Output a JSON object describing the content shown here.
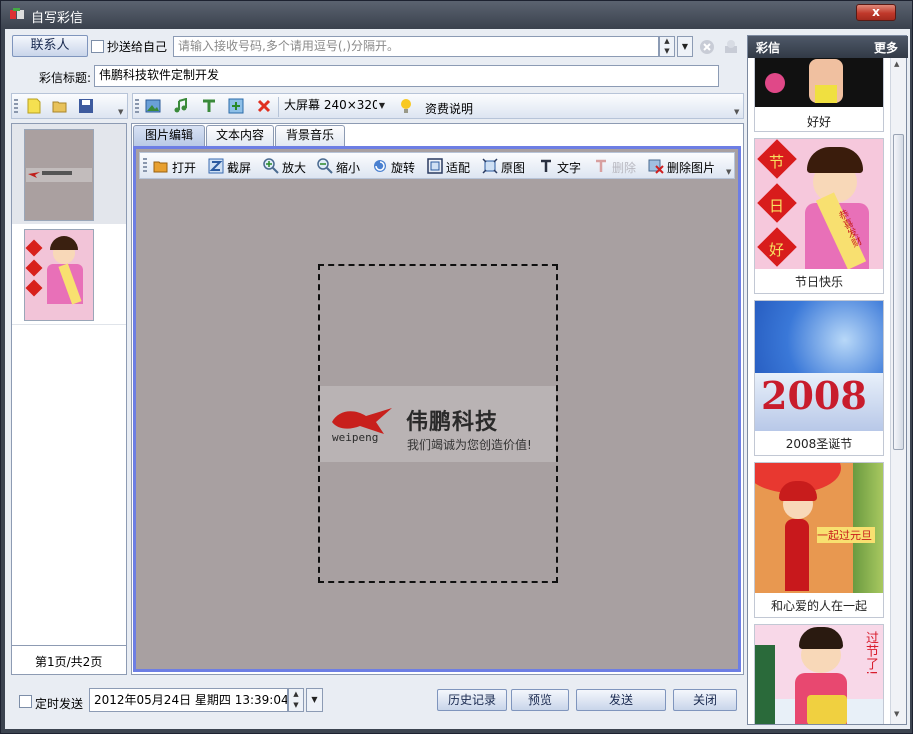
{
  "window": {
    "title": "自写彩信",
    "close_label": "x"
  },
  "header": {
    "contacts_button": "联系人",
    "cc_self_label": "抄送给自己",
    "recipient_placeholder": "请输入接收号码,多个请用逗号(,)分隔开。",
    "subject_label": "彩信标题:",
    "subject_value": "伟鹏科技软件定制开发"
  },
  "toolbar": {
    "screen_size_value": "大屏幕 240×320",
    "fee_label": "资费说明"
  },
  "slides": {
    "page_indicator": "第1页/共2页"
  },
  "tabs": [
    {
      "label": "图片编辑"
    },
    {
      "label": "文本内容"
    },
    {
      "label": "背景音乐"
    }
  ],
  "image_toolbar": {
    "open": "打开",
    "crop": "截屏",
    "zoom_in": "放大",
    "zoom_out": "缩小",
    "rotate": "旋转",
    "fit": "适配",
    "original": "原图",
    "text": "文字",
    "delete": "删除",
    "delete_image": "删除图片"
  },
  "canvas": {
    "brand_name": "伟鹏科技",
    "brand_latin": "weipeng",
    "slogan": "我们竭诚为您创造价值!"
  },
  "footer": {
    "schedule_label": "定时发送",
    "datetime_value": "2012年05月24日 星期四 13:39:04",
    "history_button": "历史记录",
    "preview_button": "预览",
    "send_button": "发送",
    "close_button": "关闭"
  },
  "gallery": {
    "title": "彩信",
    "more": "更多",
    "items": [
      {
        "caption": "好好"
      },
      {
        "caption": "节日快乐",
        "art_text": [
          "节",
          "日",
          "好"
        ],
        "scroll_text": "恭喜发财"
      },
      {
        "caption": "2008圣诞节",
        "art_text": "2008"
      },
      {
        "caption": "和心爱的人在一起",
        "art_text": "一起过元旦"
      },
      {
        "caption": "",
        "art_text": "过节了!"
      }
    ]
  },
  "colors": {
    "title_bar": "#3c4450",
    "client_bg": "#e9edf3",
    "canvas_bg": "#a8a0a1",
    "button_text": "#1a2a50"
  }
}
